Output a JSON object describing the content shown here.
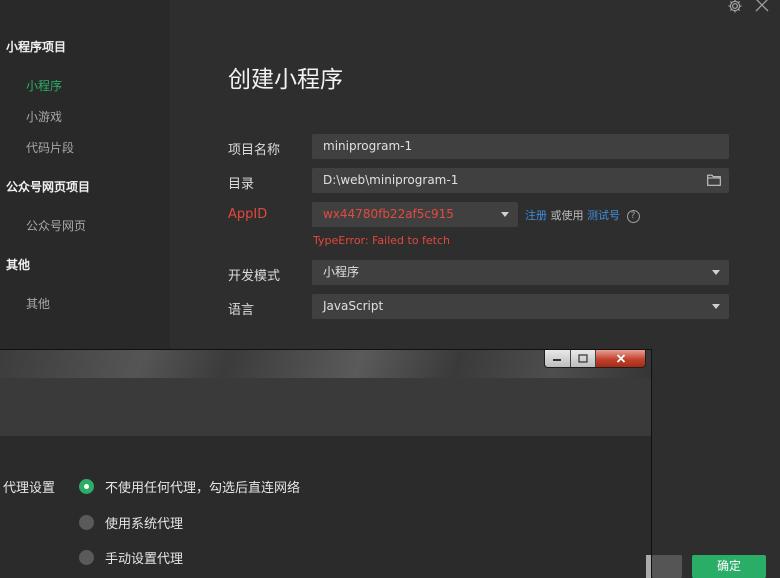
{
  "sidebar": {
    "groups": [
      {
        "title": "小程序项目",
        "items": [
          "小程序",
          "小游戏",
          "代码片段"
        ]
      },
      {
        "title": "公众号网页项目",
        "items": [
          "公众号网页"
        ]
      },
      {
        "title": "其他",
        "items": [
          "其他"
        ]
      }
    ],
    "active_item": "小程序"
  },
  "main": {
    "title": "创建小程序",
    "project_name_label": "项目名称",
    "project_name_value": "miniprogram-1",
    "directory_label": "目录",
    "directory_value": "D:\\web\\miniprogram-1",
    "appid_label": "AppID",
    "appid_value": "wx44780fb22af5c915",
    "appid_register_link": "注册",
    "appid_or_use": "或使用",
    "appid_test_link": "测试号",
    "appid_error": "TypeError: Failed to fetch",
    "dev_mode_label": "开发模式",
    "dev_mode_value": "小程序",
    "language_label": "语言",
    "language_value": "JavaScript",
    "ok_button": "确定"
  },
  "proxy_dialog": {
    "section_label": "代理设置",
    "options": [
      "不使用任何代理，勾选后直连网络",
      "使用系统代理",
      "手动设置代理"
    ],
    "selected_index": 0
  },
  "icons": {
    "settings": "gear-icon",
    "close": "close-icon",
    "folder": "folder-icon",
    "help": "question-circle-icon",
    "dropdown": "chevron-down-icon"
  },
  "colors": {
    "accent": "#2aae67",
    "error": "#e2483d",
    "link": "#3f8fe0"
  }
}
